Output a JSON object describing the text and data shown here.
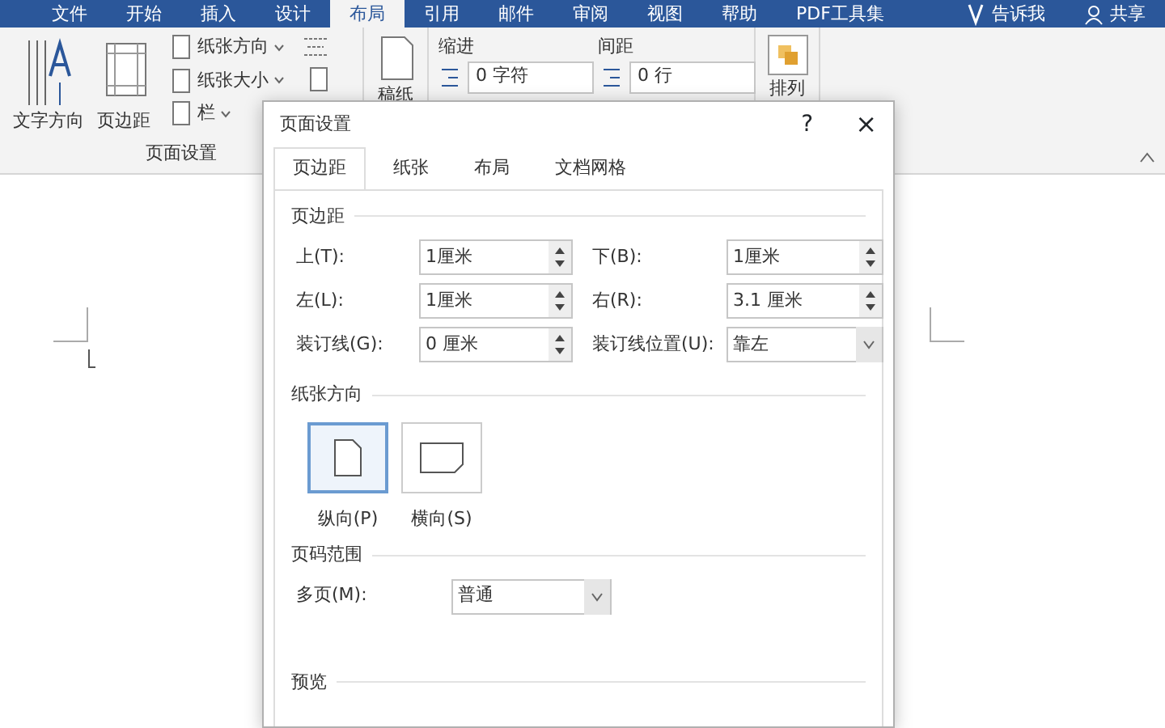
{
  "menu_tabs": [
    {
      "label": "文件",
      "selected": false
    },
    {
      "label": "开始",
      "selected": false
    },
    {
      "label": "插入",
      "selected": false
    },
    {
      "label": "设计",
      "selected": false
    },
    {
      "label": "布局",
      "selected": true
    },
    {
      "label": "引用",
      "selected": false
    },
    {
      "label": "邮件",
      "selected": false
    },
    {
      "label": "审阅",
      "selected": false
    },
    {
      "label": "视图",
      "selected": false
    },
    {
      "label": "帮助",
      "selected": false
    },
    {
      "label": "PDF工具集",
      "selected": false
    }
  ],
  "tell_me": "告诉我",
  "share": "共享",
  "ribbon": {
    "text_direction": "文字方向",
    "margins": "页边距",
    "orientation": "纸张方向",
    "size": "纸张大小",
    "columns": "栏",
    "group_label": "页面设置",
    "manuscript": "稿纸",
    "indent": {
      "label": "缩进",
      "value": "0 字符"
    },
    "spacing": {
      "label": "间距",
      "value": "0 行"
    },
    "arrange": "排列"
  },
  "dialog": {
    "title": "页面设置",
    "help": "?",
    "close": "×",
    "tabs": [
      {
        "label": "页边距",
        "selected": true
      },
      {
        "label": "纸张",
        "selected": false
      },
      {
        "label": "布局",
        "selected": false
      },
      {
        "label": "文档网格",
        "selected": false
      }
    ],
    "margins": {
      "heading": "页边距",
      "fields": [
        {
          "label": "上(T):",
          "value": "1厘米",
          "kind": "spin"
        },
        {
          "label": "下(B):",
          "value": "1厘米",
          "kind": "spin"
        },
        {
          "label": "左(L):",
          "value": "1厘米",
          "kind": "spin"
        },
        {
          "label": "右(R):",
          "value": "3.1 厘米",
          "kind": "spin"
        },
        {
          "label": "装订线(G):",
          "value": "0 厘米",
          "kind": "spin"
        },
        {
          "label": "装订线位置(U):",
          "value": "靠左",
          "kind": "dropdown"
        }
      ]
    },
    "orientation": {
      "heading": "纸张方向",
      "options": [
        {
          "label": "纵向(P)",
          "selected": true,
          "kind": "portrait"
        },
        {
          "label": "横向(S)",
          "selected": false,
          "kind": "landscape"
        }
      ]
    },
    "pages": {
      "heading": "页码范围",
      "label": "多页(M):",
      "value": "普通"
    },
    "preview": {
      "heading": "预览"
    }
  }
}
